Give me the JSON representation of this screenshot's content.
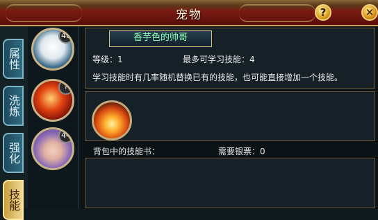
{
  "window": {
    "title": "宠物",
    "help_label": "?",
    "close_label": "✕"
  },
  "tabs": [
    {
      "label": "属性",
      "active": false
    },
    {
      "label": "洗炼",
      "active": false
    },
    {
      "label": "强化",
      "active": false
    },
    {
      "label": "技能",
      "active": true
    }
  ],
  "pets": [
    {
      "level": "46",
      "icon": "panda-pet"
    },
    {
      "level": "?",
      "icon": "fire-dragon-pet"
    },
    {
      "level": "44",
      "icon": "purple-hair-girl-pet"
    }
  ],
  "pet_name": "香芋色的帅哥",
  "info": {
    "grade": "等级：1",
    "max_learn": "最多可学习技能：4",
    "hint": "学习技能时有几率随机替换已有的技能，也可能直接增加一个技能。"
  },
  "skill": {
    "icon": "flame-skill-icon"
  },
  "footer": {
    "books": "背包中的技能书：",
    "silver": "需要银票：0"
  },
  "colors": {
    "title_bar": "#7a1a12",
    "gold_border": "#c8a060",
    "pet_name": "#8affb8"
  }
}
